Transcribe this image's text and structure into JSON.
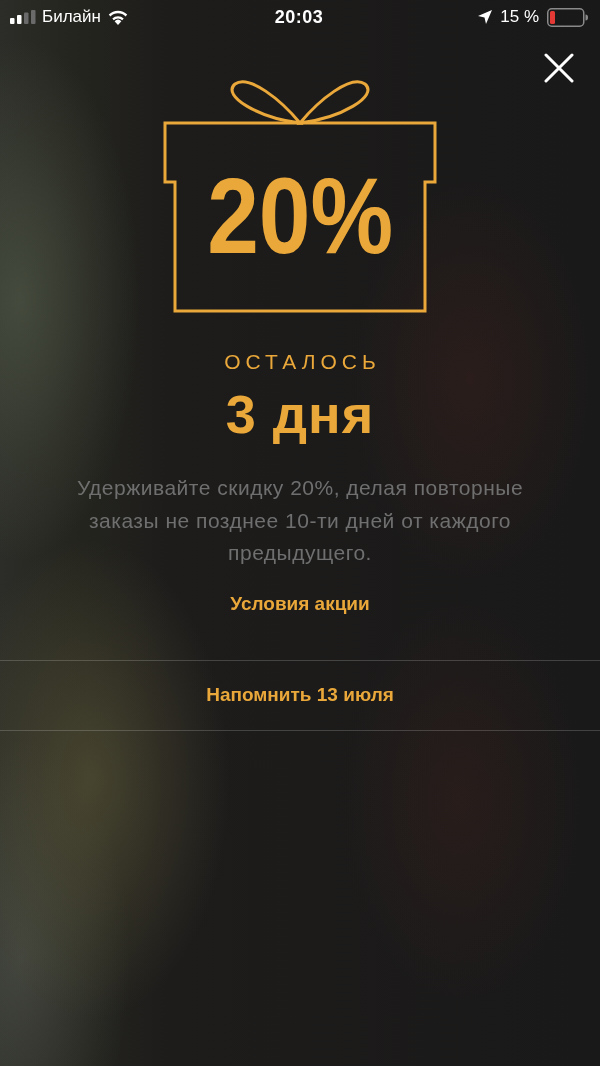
{
  "status_bar": {
    "carrier": "Билайн",
    "time": "20:03",
    "battery": "15 %"
  },
  "promo": {
    "discount": "20%",
    "remaining_label": "ОСТАЛОСЬ",
    "remaining_value": "3 дня",
    "description": "Удерживайте скидку 20%, делая повторные заказы не позднее 10-ти дней от каждого предыдущего.",
    "terms_link": "Условия акции"
  },
  "actions": [
    {
      "label": "Напомнить 13 июля"
    }
  ]
}
